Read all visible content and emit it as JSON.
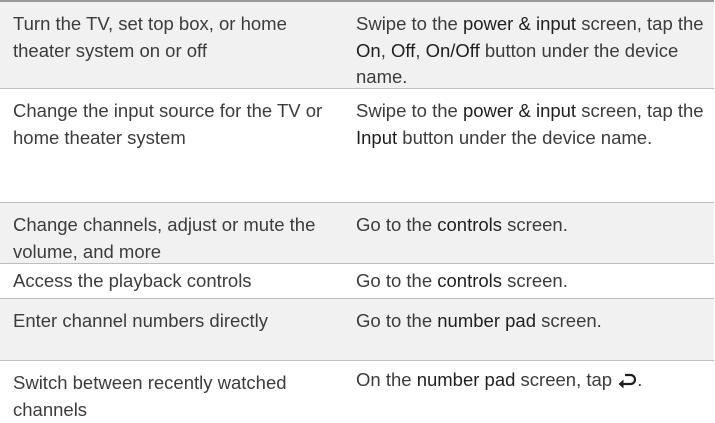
{
  "rows": [
    {
      "action": "Turn the TV, set top box, or home theater system on or off",
      "howto": [
        {
          "t": "Swipe to the "
        },
        {
          "t": "power & input",
          "b": true
        },
        {
          "t": " screen, tap the "
        },
        {
          "t": "On",
          "b": true
        },
        {
          "t": ", "
        },
        {
          "t": "Off",
          "b": true
        },
        {
          "t": ", "
        },
        {
          "t": "On/Off",
          "b": true
        },
        {
          "t": " button under the device name."
        }
      ]
    },
    {
      "action": "Change the input source for the TV or home theater system",
      "howto": [
        {
          "t": "Swipe to the "
        },
        {
          "t": "power & input",
          "b": true
        },
        {
          "t": " screen, tap the "
        },
        {
          "t": "Input",
          "b": true
        },
        {
          "t": " button under the device name."
        }
      ]
    },
    {
      "action": "Change channels, adjust or mute the volume, and more",
      "howto": [
        {
          "t": "Go to the "
        },
        {
          "t": "controls",
          "b": true
        },
        {
          "t": " screen."
        }
      ]
    },
    {
      "action": "Access the playback controls",
      "howto": [
        {
          "t": "Go to the "
        },
        {
          "t": "controls",
          "b": true
        },
        {
          "t": " screen."
        }
      ]
    },
    {
      "action": "Enter channel numbers directly",
      "howto": [
        {
          "t": "Go to the "
        },
        {
          "t": "number pad",
          "b": true
        },
        {
          "t": " screen."
        }
      ]
    },
    {
      "action": "Switch between recently watched channels",
      "howto": [
        {
          "t": "On the "
        },
        {
          "t": "number pad",
          "b": true
        },
        {
          "t": " screen, tap "
        },
        {
          "icon": "return-arrow-icon"
        },
        {
          "t": "."
        }
      ]
    }
  ]
}
